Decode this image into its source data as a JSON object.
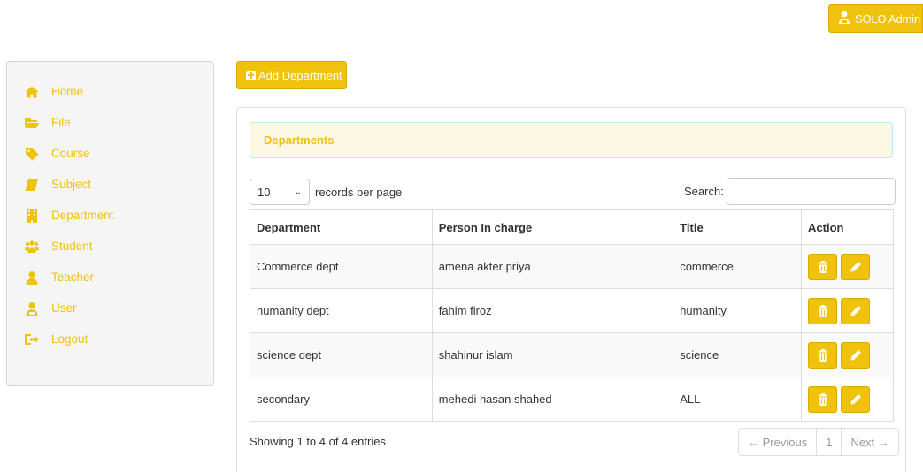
{
  "header": {
    "admin_label": "SOLO Admin",
    "admin_icon": "user-admin-icon"
  },
  "sidebar": {
    "items": [
      {
        "label": "Home",
        "icon": "home-icon"
      },
      {
        "label": "File",
        "icon": "folder-open-icon"
      },
      {
        "label": "Course",
        "icon": "tag-icon"
      },
      {
        "label": "Subject",
        "icon": "book-icon"
      },
      {
        "label": "Department",
        "icon": "building-icon"
      },
      {
        "label": "Student",
        "icon": "users-icon"
      },
      {
        "label": "Teacher",
        "icon": "user-icon"
      },
      {
        "label": "User",
        "icon": "user-admin-icon"
      },
      {
        "label": "Logout",
        "icon": "logout-icon"
      }
    ]
  },
  "toolbar": {
    "add_label": "Add Department"
  },
  "panel": {
    "title": "Departments"
  },
  "table_controls": {
    "length_value": "10",
    "length_label": "records per page",
    "search_label": "Search:"
  },
  "table": {
    "columns": [
      "Department",
      "Person In charge",
      "Title",
      "Action"
    ],
    "rows": [
      {
        "department": "Commerce dept",
        "person": "amena akter priya",
        "title": "commerce"
      },
      {
        "department": "humanity dept",
        "person": "fahim firoz",
        "title": "humanity"
      },
      {
        "department": "science dept",
        "person": "shahinur islam",
        "title": "science"
      },
      {
        "department": "secondary",
        "person": "mehedi hasan shahed",
        "title": "ALL"
      }
    ]
  },
  "footer": {
    "info": "Showing 1 to 4 of 4 entries",
    "prev": "← Previous",
    "page": "1",
    "next": "Next →"
  },
  "colors": {
    "accent": "#f0c20b",
    "panel_heading_bg": "#fcf8e3"
  }
}
